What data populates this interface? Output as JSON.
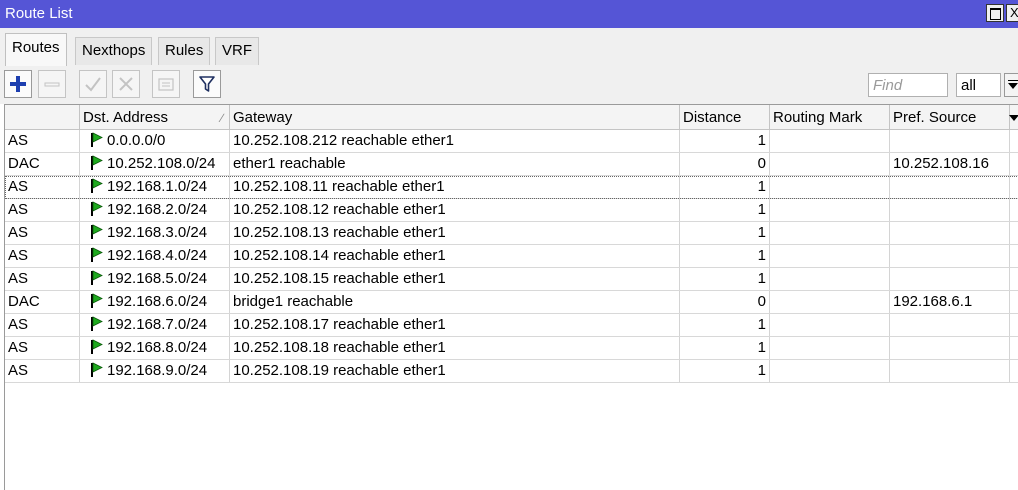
{
  "window": {
    "title": "Route List",
    "maximize_icon": "maximize-icon",
    "close_label": "X"
  },
  "tabs": [
    {
      "label": "Routes",
      "active": true
    },
    {
      "label": "Nexthops",
      "active": false
    },
    {
      "label": "Rules",
      "active": false
    },
    {
      "label": "VRF",
      "active": false
    }
  ],
  "toolbar": {
    "buttons": [
      {
        "name": "add-button",
        "icon": "plus-icon",
        "enabled": true
      },
      {
        "name": "remove-button",
        "icon": "minus-icon",
        "enabled": false
      },
      {
        "name": "enable-button",
        "icon": "check-icon",
        "enabled": false
      },
      {
        "name": "disable-button",
        "icon": "x-icon",
        "enabled": false
      },
      {
        "name": "comment-button",
        "icon": "comment-icon",
        "enabled": false
      },
      {
        "name": "filter-button",
        "icon": "funnel-icon",
        "enabled": true
      }
    ],
    "find_placeholder": "Find",
    "scope_value": "all"
  },
  "colors": {
    "titlebar": "#5555d6",
    "flag": "#1faa1f",
    "add_icon": "#1d3fb0"
  },
  "table": {
    "columns": [
      "",
      "Dst. Address",
      "Gateway",
      "Distance",
      "Routing Mark",
      "Pref. Source"
    ],
    "rows": [
      {
        "flags": "AS",
        "dst": "0.0.0.0/0",
        "gateway": "10.252.108.212 reachable ether1",
        "distance": "1",
        "mark": "",
        "pref": ""
      },
      {
        "flags": "DAC",
        "dst": "10.252.108.0/24",
        "gateway": "ether1 reachable",
        "distance": "0",
        "mark": "",
        "pref": "10.252.108.16"
      },
      {
        "flags": "AS",
        "dst": "192.168.1.0/24",
        "gateway": "10.252.108.11 reachable ether1",
        "distance": "1",
        "mark": "",
        "pref": ""
      },
      {
        "flags": "AS",
        "dst": "192.168.2.0/24",
        "gateway": "10.252.108.12 reachable ether1",
        "distance": "1",
        "mark": "",
        "pref": ""
      },
      {
        "flags": "AS",
        "dst": "192.168.3.0/24",
        "gateway": "10.252.108.13 reachable ether1",
        "distance": "1",
        "mark": "",
        "pref": ""
      },
      {
        "flags": "AS",
        "dst": "192.168.4.0/24",
        "gateway": "10.252.108.14 reachable ether1",
        "distance": "1",
        "mark": "",
        "pref": ""
      },
      {
        "flags": "AS",
        "dst": "192.168.5.0/24",
        "gateway": "10.252.108.15 reachable ether1",
        "distance": "1",
        "mark": "",
        "pref": ""
      },
      {
        "flags": "DAC",
        "dst": "192.168.6.0/24",
        "gateway": "bridge1 reachable",
        "distance": "0",
        "mark": "",
        "pref": "192.168.6.1"
      },
      {
        "flags": "AS",
        "dst": "192.168.7.0/24",
        "gateway": "10.252.108.17 reachable ether1",
        "distance": "1",
        "mark": "",
        "pref": ""
      },
      {
        "flags": "AS",
        "dst": "192.168.8.0/24",
        "gateway": "10.252.108.18 reachable ether1",
        "distance": "1",
        "mark": "",
        "pref": ""
      },
      {
        "flags": "AS",
        "dst": "192.168.9.0/24",
        "gateway": "10.252.108.19 reachable ether1",
        "distance": "1",
        "mark": "",
        "pref": ""
      }
    ],
    "selected_row": 2
  }
}
